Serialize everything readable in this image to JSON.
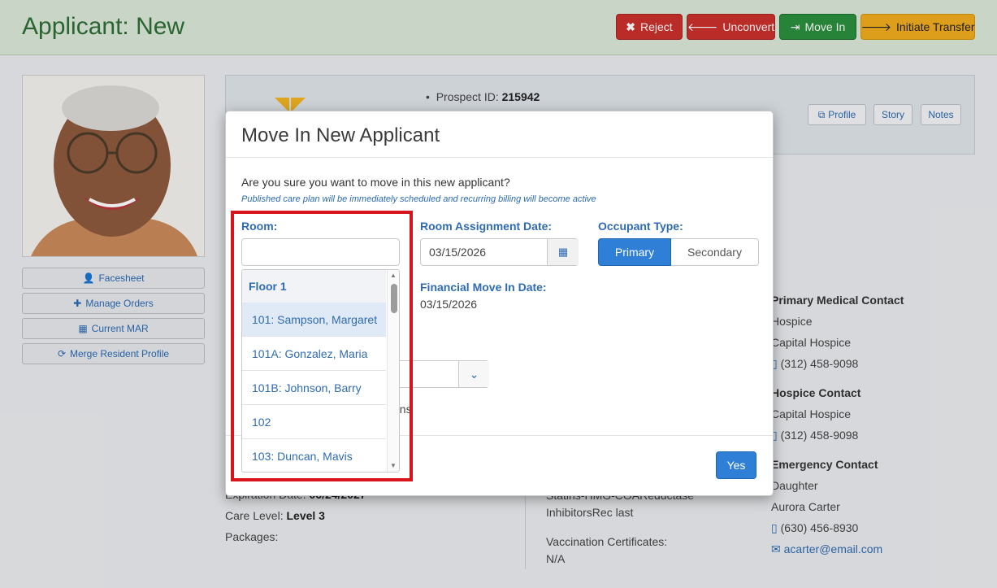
{
  "header": {
    "title": "Applicant: New",
    "buttons": {
      "reject": "Reject",
      "unconvert": "Unconvert",
      "move_in": "Move In",
      "initiate_transfer": "Initiate Transfer"
    }
  },
  "sidebar": {
    "buttons": {
      "facesheet": "Facesheet",
      "manage_orders": "Manage Orders",
      "current_mar": "Current MAR",
      "merge_profile": "Merge Resident Profile"
    }
  },
  "profile": {
    "prospect_label": "Prospect ID:",
    "prospect_id": "215942",
    "buttons": {
      "profile": "Profile",
      "story": "Story",
      "notes": "Notes"
    }
  },
  "background": {
    "expiration_label": "Expiration Date:",
    "expiration_value": "06/24/2027",
    "care_level_label": "Care Level:",
    "care_level_value": "Level 3",
    "packages_label": "Packages:",
    "medication_line1": "Statins-HMG-COAReductase",
    "medication_line2": "InhibitorsRec last",
    "vaccination_label": "Vaccination Certificates:",
    "vaccination_value": "N/A",
    "partial_text": "ons",
    "contacts": {
      "primary_medical": {
        "title": "Primary Medical Contact",
        "type": "Hospice",
        "name": "Capital Hospice",
        "phone": "(312) 458-9098"
      },
      "hospice": {
        "title": "Hospice Contact",
        "name": "Capital Hospice",
        "phone": "(312) 458-9098"
      },
      "emergency": {
        "title": "Emergency Contact",
        "relation": "Daughter",
        "name": "Aurora Carter",
        "phone": "(630) 456-8930",
        "email": "acarter@email.com"
      }
    }
  },
  "modal": {
    "title": "Move In New Applicant",
    "question": "Are you sure you want to move in this new applicant?",
    "note": "Published care plan will be immediately scheduled and recurring billing will become active",
    "room_label": "Room:",
    "room_value": "",
    "room_assignment_label": "Room Assignment Date:",
    "room_assignment_date": "03/15/2026",
    "occupant_type_label": "Occupant Type:",
    "occupant_options": [
      "Primary",
      "Secondary"
    ],
    "occupant_selected": "Primary",
    "financial_label": "Financial Move In Date:",
    "financial_date": "03/15/2026",
    "yes_label": "Yes"
  },
  "room_dropdown": {
    "group": "Floor 1",
    "items": [
      "101: Sampson, Margaret",
      "101A: Gonzalez, Maria",
      "101B: Johnson, Barry",
      "102",
      "103: Duncan, Mavis"
    ],
    "selected": "101: Sampson, Margaret"
  },
  "colors": {
    "header_bg": "#dbe9d8",
    "title_green": "#2e6d36",
    "danger": "#c9302c",
    "success": "#2b8f3d",
    "warning": "#f0ad1e",
    "primary": "#2f7fd6",
    "label_blue": "#2f6bb0",
    "highlight_red": "#d7141b"
  },
  "icons": [
    "times-icon",
    "arrow-left-icon",
    "sign-in-icon",
    "arrow-right-icon",
    "user-icon",
    "medkit-icon",
    "calendar-icon",
    "refresh-icon",
    "external-link-icon",
    "phone-icon",
    "envelope-icon",
    "chevron-down-icon",
    "butterfly-logo"
  ]
}
